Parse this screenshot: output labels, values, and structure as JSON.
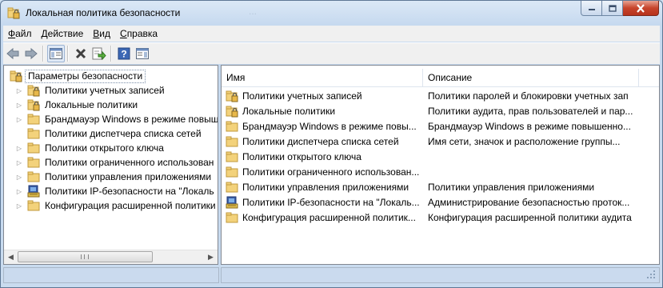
{
  "window": {
    "title": "Локальная политика безопасности",
    "ghost_text": "...",
    "buttons": {
      "minimize": "minimize-icon",
      "maximize": "maximize-icon",
      "close": "close-icon"
    }
  },
  "menu": {
    "items": [
      {
        "label": "Файл",
        "key": "Ф",
        "rest": "айл"
      },
      {
        "label": "Действие",
        "key": "Д",
        "rest": "ействие"
      },
      {
        "label": "Вид",
        "key": "В",
        "rest": "ид"
      },
      {
        "label": "Справка",
        "key": "С",
        "rest": "правка"
      }
    ]
  },
  "toolbar": {
    "buttons": [
      "back-icon",
      "forward-icon",
      "show-hide-tree-icon",
      "delete-icon",
      "export-list-icon",
      "help-icon",
      "action-pane-icon"
    ]
  },
  "tree": {
    "root": "Параметры безопасности",
    "items": [
      {
        "label": "Политики учетных записей",
        "icon": "locked-folder-icon",
        "expandable": true
      },
      {
        "label": "Локальные политики",
        "icon": "locked-folder-icon",
        "expandable": true
      },
      {
        "label": "Брандмауэр Windows в режиме повыш",
        "icon": "folder-icon",
        "expandable": true
      },
      {
        "label": "Политики диспетчера списка сетей",
        "icon": "folder-icon",
        "expandable": false
      },
      {
        "label": "Политики открытого ключа",
        "icon": "folder-icon",
        "expandable": true
      },
      {
        "label": "Политики ограниченного использован",
        "icon": "folder-icon",
        "expandable": true
      },
      {
        "label": "Политики управления приложениями",
        "icon": "folder-icon",
        "expandable": true
      },
      {
        "label": "Политики IP-безопасности на \"Локаль",
        "icon": "ipsec-icon",
        "expandable": true
      },
      {
        "label": "Конфигурация расширенной политики",
        "icon": "folder-icon",
        "expandable": true
      }
    ]
  },
  "list": {
    "columns": [
      "Имя",
      "Описание"
    ],
    "rows": [
      {
        "name": "Политики учетных записей",
        "desc": "Политики паролей и блокировки учетных зап",
        "icon": "locked-folder-icon"
      },
      {
        "name": "Локальные политики",
        "desc": "Политики аудита, прав пользователей и пар...",
        "icon": "locked-folder-icon"
      },
      {
        "name": "Брандмауэр Windows в режиме повы...",
        "desc": "Брандмауэр Windows в режиме повышенно...",
        "icon": "folder-icon"
      },
      {
        "name": "Политики диспетчера списка сетей",
        "desc": "Имя сети, значок и расположение группы...",
        "icon": "folder-icon"
      },
      {
        "name": "Политики открытого ключа",
        "desc": "",
        "icon": "folder-icon"
      },
      {
        "name": "Политики ограниченного использован...",
        "desc": "",
        "icon": "folder-icon"
      },
      {
        "name": "Политики управления приложениями",
        "desc": "Политики управления приложениями",
        "icon": "folder-icon"
      },
      {
        "name": "Политики IP-безопасности на \"Локаль...",
        "desc": "Администрирование безопасностью проток...",
        "icon": "ipsec-icon"
      },
      {
        "name": "Конфигурация расширенной политик...",
        "desc": "Конфигурация расширенной политики аудита",
        "icon": "folder-icon"
      }
    ]
  },
  "colors": {
    "frame": "#cfe0f2",
    "folder": "#f3d27b",
    "close": "#c7442b"
  }
}
